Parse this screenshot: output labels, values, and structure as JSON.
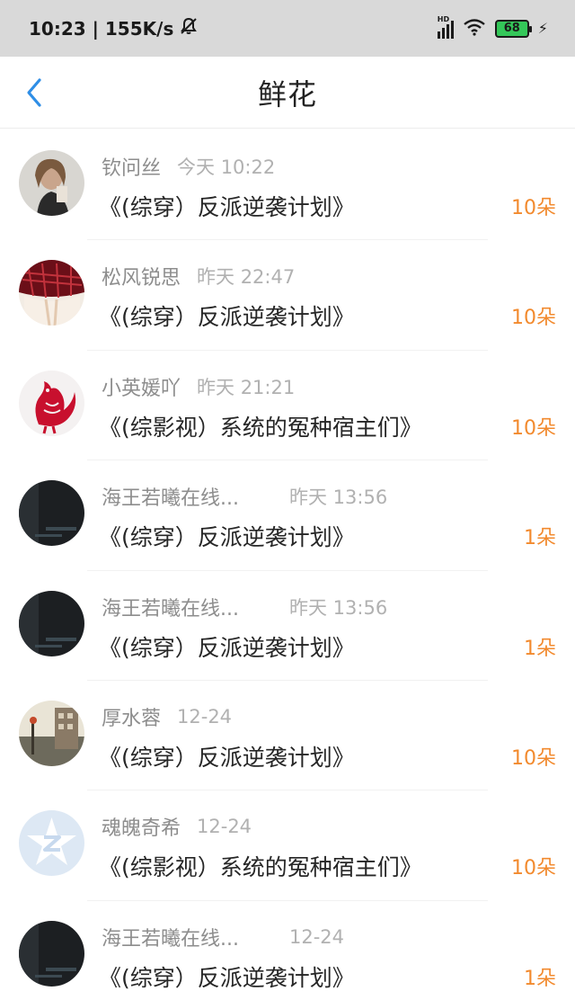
{
  "status_bar": {
    "time_speed": "10:23 | 155K/s",
    "network_badge": "HD",
    "battery_level": "68",
    "icons": [
      "bell-off-icon",
      "signal-icon",
      "wifi-icon",
      "battery-icon",
      "charging-icon"
    ]
  },
  "header": {
    "title": "鲜花",
    "back_icon": "chevron-left-icon",
    "accent_color": "#2f8ee6"
  },
  "colors": {
    "flower_count": "#f28a2e",
    "user_name": "#8d8d8d",
    "time": "#b1b1b1",
    "title": "#262626"
  },
  "items": [
    {
      "user": "钦问丝",
      "time": "今天 10:22",
      "book": "《(综穿）反派逆袭计划》",
      "count": "10朵",
      "avatar": "portrait-avatar"
    },
    {
      "user": "松风锐思",
      "time": "昨天 22:47",
      "book": "《(综穿）反派逆袭计划》",
      "count": "10朵",
      "avatar": "red-pattern-avatar"
    },
    {
      "user": "小英媛吖",
      "time": "昨天 21:21",
      "book": "《(综影视）系统的冤种宿主们》",
      "count": "10朵",
      "avatar": "rooster-avatar"
    },
    {
      "user": "海王若曦在线...",
      "time": "昨天 13:56",
      "book": "《(综穿）反派逆袭计划》",
      "count": "1朵",
      "avatar": "dark-avatar"
    },
    {
      "user": "海王若曦在线...",
      "time": "昨天 13:56",
      "book": "《(综穿）反派逆袭计划》",
      "count": "1朵",
      "avatar": "dark-avatar"
    },
    {
      "user": "厚水蓉",
      "time": "12-24",
      "book": "《(综穿）反派逆袭计划》",
      "count": "10朵",
      "avatar": "street-avatar"
    },
    {
      "user": "魂魄奇希",
      "time": "12-24",
      "book": "《(综影视）系统的冤种宿主们》",
      "count": "10朵",
      "avatar": "default-z-avatar"
    },
    {
      "user": "海王若曦在线...",
      "time": "12-24",
      "book": "《(综穿）反派逆袭计划》",
      "count": "1朵",
      "avatar": "dark-avatar"
    }
  ]
}
